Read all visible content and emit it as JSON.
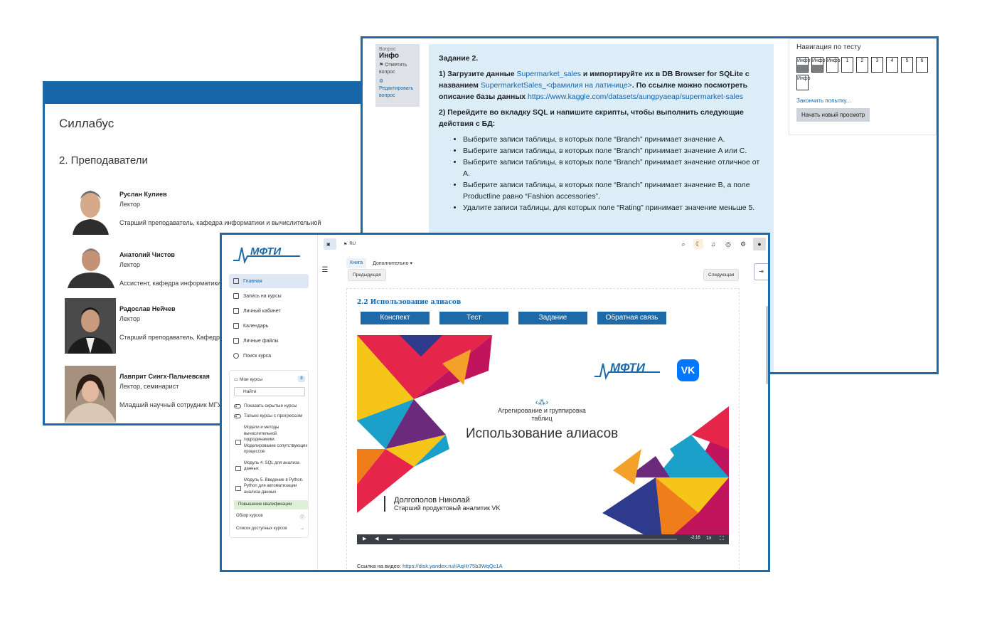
{
  "syllabus": {
    "title": "Силлабус",
    "section": "2. Преподаватели",
    "teachers": [
      {
        "name": "Руслан Кулиев",
        "role": "Лектор",
        "desc": "Старший преподаватель, кафедра информатики и вычислительной"
      },
      {
        "name": "Анатолий Чистов",
        "role": "Лектор",
        "desc": "Ассистент, кафедра информатики"
      },
      {
        "name": "Радослав Нейчев",
        "role": "Лектор",
        "desc": "Старший преподаватель, Кафедра"
      },
      {
        "name": "Лавприт Сингх-Пальчевская",
        "role": "Лектор, семинарист",
        "desc": "Младший научный сотрудник МГУ"
      }
    ]
  },
  "quiz": {
    "info": {
      "label": "Вопрос",
      "title": "Инфо",
      "flag": "Отметить вопрос",
      "edit": "Редактировать вопрос"
    },
    "task_title": "Задание 2.",
    "p1": {
      "a": "1) Загрузите данные ",
      "link1": "Supermarket_sales",
      "b": " и импортируйте их в DB Browser for SQLite с названием ",
      "link2": "SupermarketSales_<фамилия на латинице>",
      "c": ". По ссылке можно посмотреть описание базы данных ",
      "link3": "https://www.kaggle.com/datasets/aungpyaeap/supermarket-sales"
    },
    "p2": "2) Перейдите во вкладку SQL и напишите скрипты, чтобы выполнить следующие действия с БД:",
    "items": [
      "Выберите записи таблицы, в которых поле “Branch” принимает значение A.",
      "Выберите записи таблицы, в которых поле “Branch” принимает значение A или C.",
      "Выберите записи таблицы, в которых поле “Branch” принимает значение отличное от А.",
      "Выберите записи таблицы, в которых поле “Branch” принимает значение B, а поле Productline равно “Fashion accessories”.",
      "Удалите записи таблицы, для которых поле “Rating” принимает значение меньше 5."
    ],
    "nav": {
      "title": "Навигация по тесту",
      "cells": [
        "Инфо",
        "Инфо",
        "Инфо",
        "1",
        "2",
        "3",
        "4",
        "5",
        "6",
        "Инфо"
      ],
      "finish": "Закончить попытку...",
      "new_view": "Начать новый просмотр"
    }
  },
  "course": {
    "logo_text": "МФТИ",
    "lang": "RU",
    "sidebar": [
      {
        "label": "Главная",
        "active": true
      },
      {
        "label": "Запись на курсы"
      },
      {
        "label": "Личный кабинет"
      },
      {
        "label": "Календарь"
      },
      {
        "label": "Личные файлы"
      },
      {
        "label": "Поиск курса"
      }
    ],
    "my_courses": "Мои курсы",
    "my_courses_count": "8",
    "search_placeholder": "Найти",
    "show_hidden": "Показать скрытые курсы",
    "only_progress": "Только курсы с прогрессом",
    "courses": [
      "Модели и методы вычислительной гидродинамики. Моделирование сопутствующих процессов",
      "Модуль 4. SQL для анализа данных",
      "Модуль 5. Введение в Python. Python для автоматизации анализа данных"
    ],
    "highlight": "Повышение квалификации",
    "overview": "Обзор курсов",
    "available": "Список доступных курсов",
    "tabs": [
      "Книга",
      "Дополнительно ▾"
    ],
    "prev": "Предыдущая",
    "next": "Следующая",
    "page_title": "2.2 Использование алиасов",
    "buttons": [
      "Конспект",
      "Тест",
      "Задание",
      "Обратная связь"
    ],
    "video": {
      "subtitle": "Агрегирование и группировка таблиц",
      "title": "Использование алиасов",
      "author": "Долгополов Николай",
      "position": "Старший продуктовый аналитик VK",
      "time": "-2:16",
      "speed": "1x"
    },
    "link_label": "Ссылка на видео: ",
    "link_url": "https://disk.yandex.ru/i/AqHr75b3WqQc1A"
  },
  "colors": {
    "accent": "#1e6aa8",
    "question_bg": "#dcedf7",
    "vk": "#0077ff"
  }
}
